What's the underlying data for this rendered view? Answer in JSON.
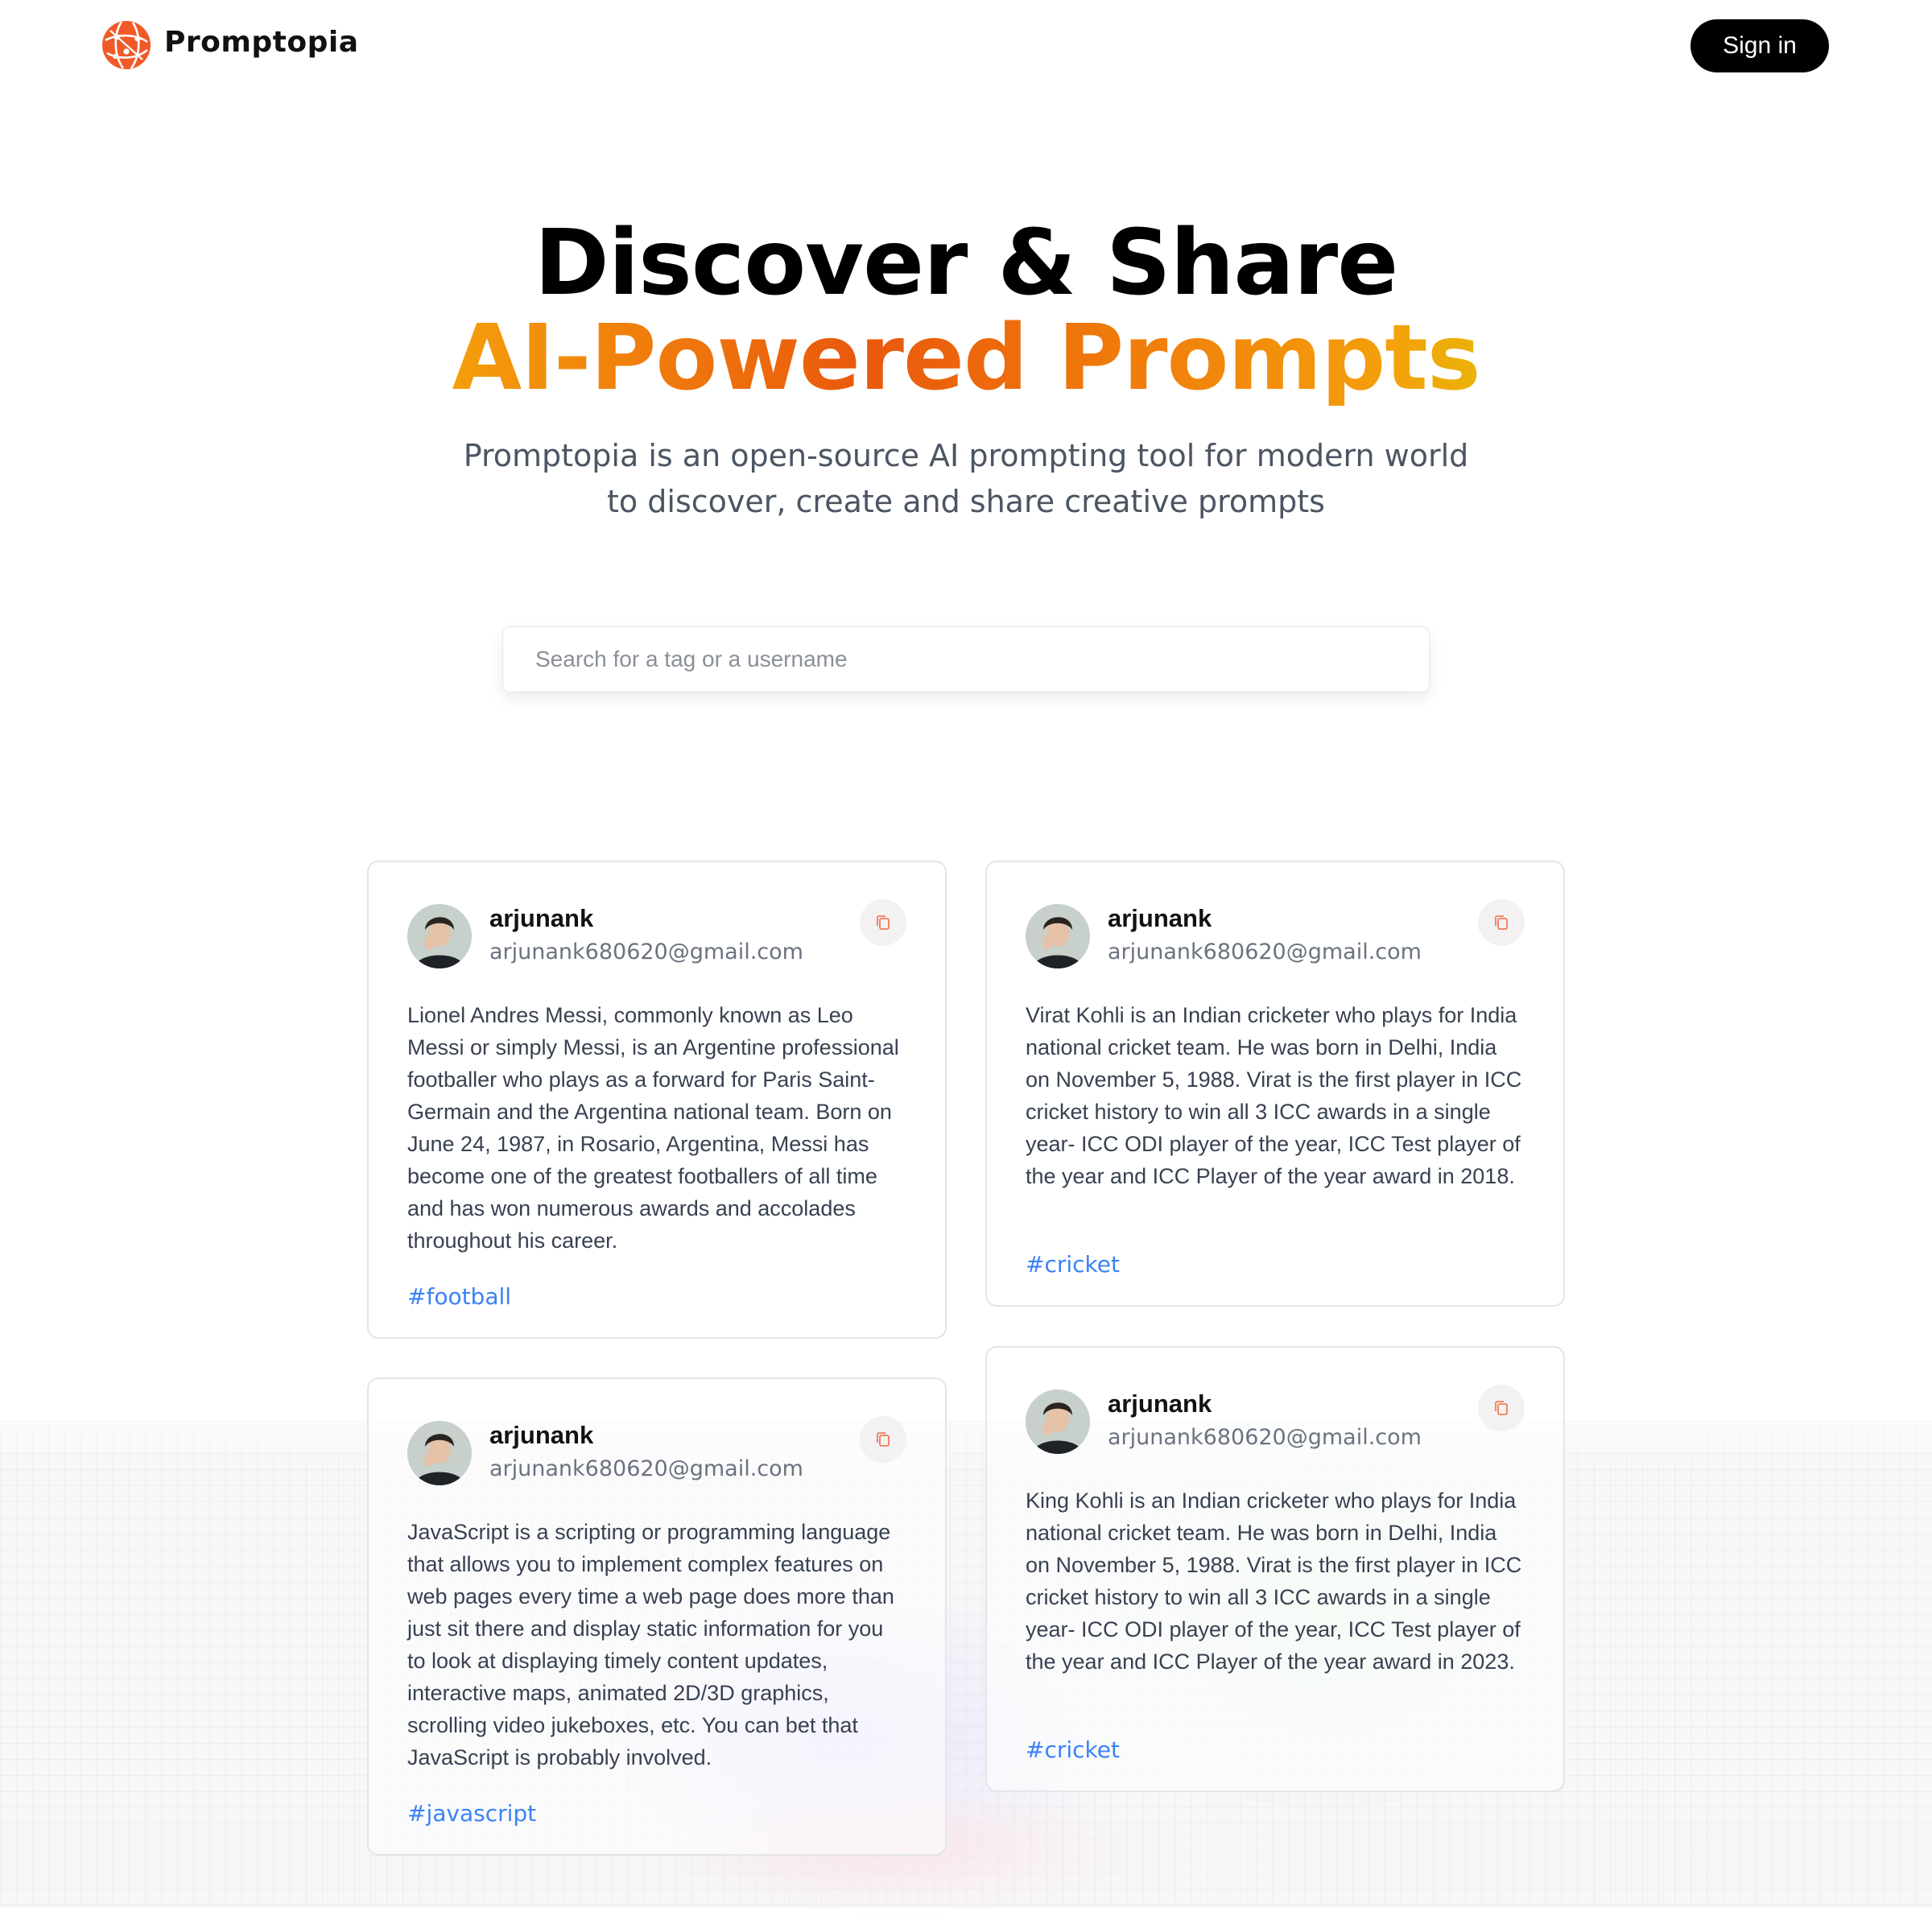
{
  "brand": {
    "name": "Promptopia"
  },
  "nav": {
    "signin_label": "Sign in"
  },
  "hero": {
    "title_line1": "Discover & Share",
    "title_line2": "AI-Powered Prompts",
    "description": "Promptopia is an open-source AI prompting tool for modern world to discover, create and share creative prompts"
  },
  "search": {
    "placeholder": "Search for a tag or a username",
    "value": ""
  },
  "colors": {
    "accent_orange": "#ea580c",
    "accent_amber": "#f59e0b",
    "tag_blue": "#3b82f6",
    "button_black": "#000000"
  },
  "prompts": [
    {
      "username": "arjunank",
      "email": "arjunank680620@gmail.com",
      "text": "Lionel Andres Messi, commonly known as Leo Messi or simply Messi, is an Argentine professional footballer who plays as a forward for Paris Saint-Germain and the Argentina national team. Born on June 24, 1987, in Rosario, Argentina, Messi has become one of the greatest footballers of all time and has won numerous awards and accolades throughout his career.",
      "tag": "#football",
      "copy_icon": "copy-icon"
    },
    {
      "username": "arjunank",
      "email": "arjunank680620@gmail.com",
      "text": "Virat Kohli is an Indian cricketer who plays for India national cricket team. He was born in Delhi, India on November 5, 1988. Virat is the first player in ICC cricket history to win all 3 ICC awards in a single year- ICC ODI player of the year, ICC Test player of the year and ICC Player of the year award in 2018.",
      "tag": "#cricket",
      "copy_icon": "copy-icon"
    },
    {
      "username": "arjunank",
      "email": "arjunank680620@gmail.com",
      "text": "JavaScript is a scripting or programming language that allows you to implement complex features on web pages every time a web page does more than just sit there and display static information for you to look at displaying timely content updates, interactive maps, animated 2D/3D graphics, scrolling video jukeboxes, etc. You can bet that JavaScript is probably involved.",
      "tag": "#javascript",
      "copy_icon": "copy-icon"
    },
    {
      "username": "arjunank",
      "email": "arjunank680620@gmail.com",
      "text": "King Kohli is an Indian cricketer who plays for India national cricket team. He was born in Delhi, India on November 5, 1988. Virat is the first player in ICC cricket history to win all 3 ICC awards in a single year- ICC ODI player of the year, ICC Test player of the year and ICC Player of the year award in 2023.",
      "tag": "#cricket",
      "copy_icon": "copy-icon"
    }
  ]
}
